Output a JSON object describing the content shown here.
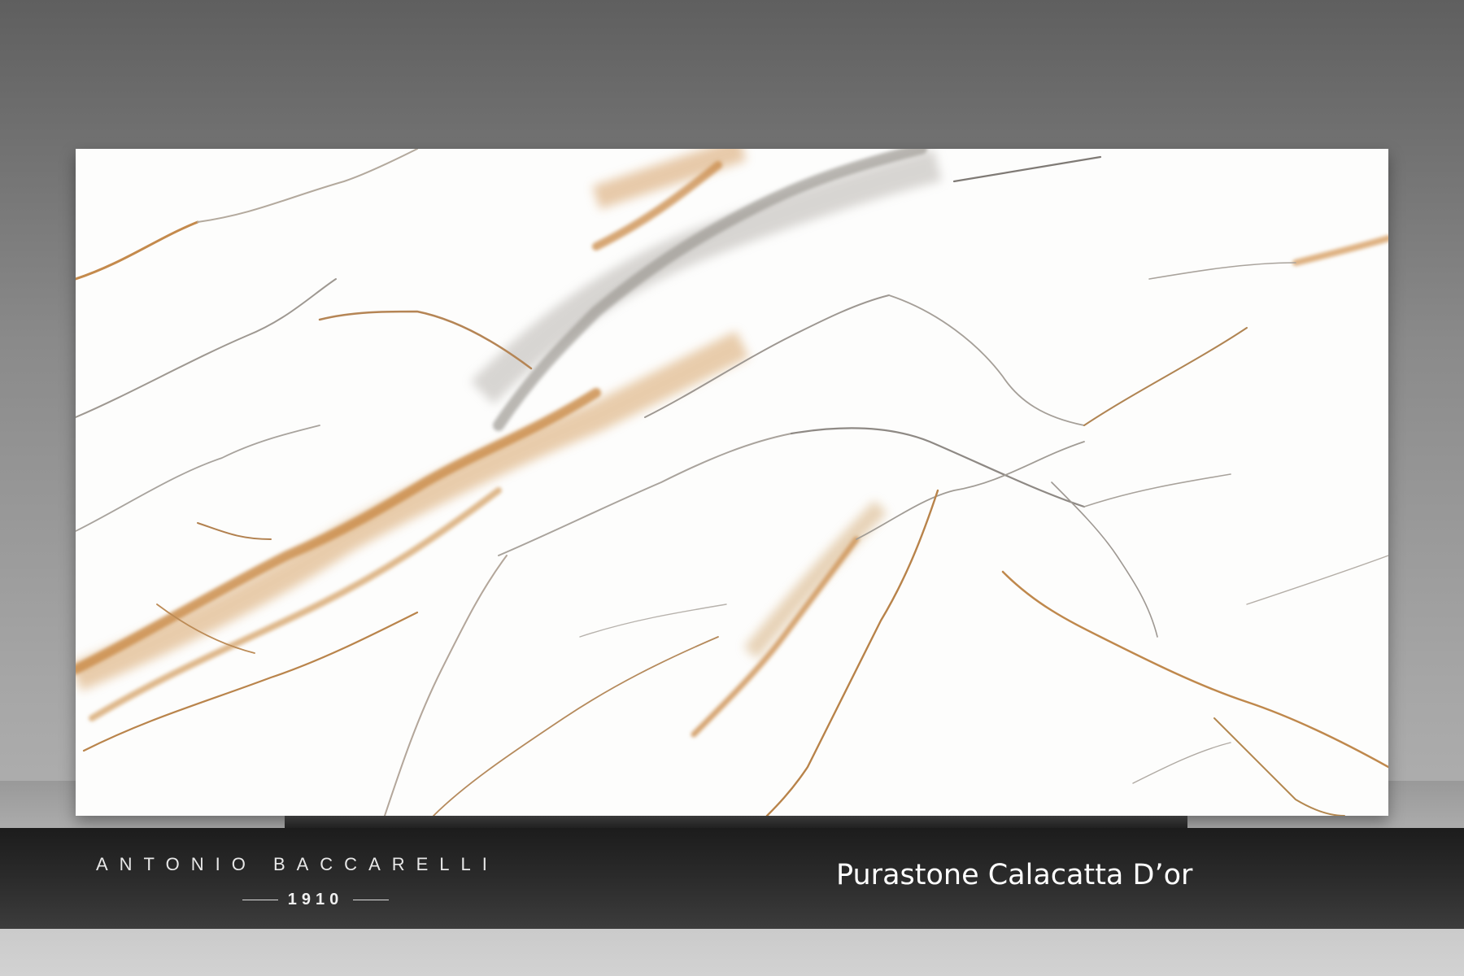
{
  "brand": {
    "name": "ANTONIO BACCARELLI",
    "year": "1910"
  },
  "product": {
    "name": "Purastone Calacatta D’or"
  },
  "colors": {
    "slab": "#fdfdfc",
    "vein_gold": "#c98a45",
    "vein_grey": "#8f8b86",
    "banner": "#2a2a2a",
    "text": "#ffffff"
  }
}
